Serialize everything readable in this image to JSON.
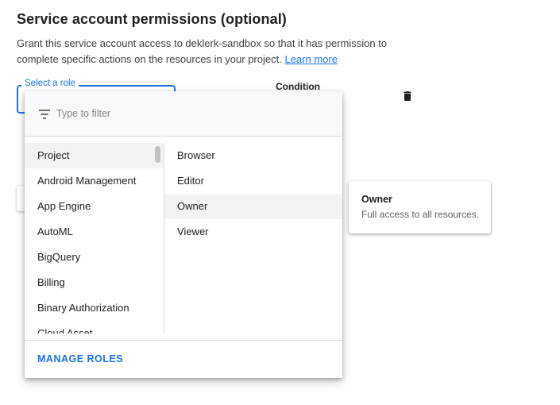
{
  "section": {
    "title": "Service account permissions (optional)",
    "description": "Grant this service account access to deklerk-sandbox so that it has permission to complete specific actions on the resources in your project.",
    "learn_more": "Learn more"
  },
  "role_field": {
    "label": "Select a role"
  },
  "condition": {
    "label": "Condition"
  },
  "icons": {
    "delete": "trash-icon",
    "filter": "filter-icon"
  },
  "dropdown": {
    "filter_placeholder": "Type to filter",
    "categories": [
      "Project",
      "Android Management",
      "App Engine",
      "AutoML",
      "BigQuery",
      "Billing",
      "Binary Authorization",
      "Cloud Asset"
    ],
    "selected_category": "Project",
    "roles": [
      "Browser",
      "Editor",
      "Owner",
      "Viewer"
    ],
    "highlighted_role": "Owner",
    "manage_roles": "MANAGE ROLES"
  },
  "tooltip": {
    "title": "Owner",
    "description": "Full access to all resources."
  },
  "colors": {
    "accent": "#1a73e8",
    "selected_bg": "#f1f3f4",
    "divider": "#dadce0"
  }
}
